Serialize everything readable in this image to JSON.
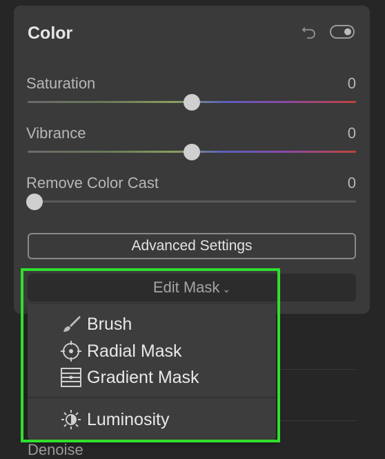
{
  "panel": {
    "title": "Color"
  },
  "sliders": [
    {
      "label": "Saturation",
      "value": "0",
      "position": 0.5
    },
    {
      "label": "Vibrance",
      "value": "0",
      "position": 0.5
    },
    {
      "label": "Remove Color Cast",
      "value": "0",
      "position": 0.0
    }
  ],
  "advanced_button": {
    "label": "Advanced Settings"
  },
  "edit_mask": {
    "label": "Edit Mask",
    "chevron": "⌄"
  },
  "dropdown": {
    "items": [
      {
        "label": "Brush",
        "icon": "brush-icon"
      },
      {
        "label": "Radial Mask",
        "icon": "radial-mask-icon"
      },
      {
        "label": "Gradient Mask",
        "icon": "gradient-mask-icon"
      },
      {
        "label": "Luminosity",
        "icon": "luminosity-icon"
      }
    ]
  },
  "background": {
    "next_section_label": "Denoise"
  },
  "colors": {
    "highlight": "#2ee02e",
    "panel": "#3a3a3a"
  }
}
